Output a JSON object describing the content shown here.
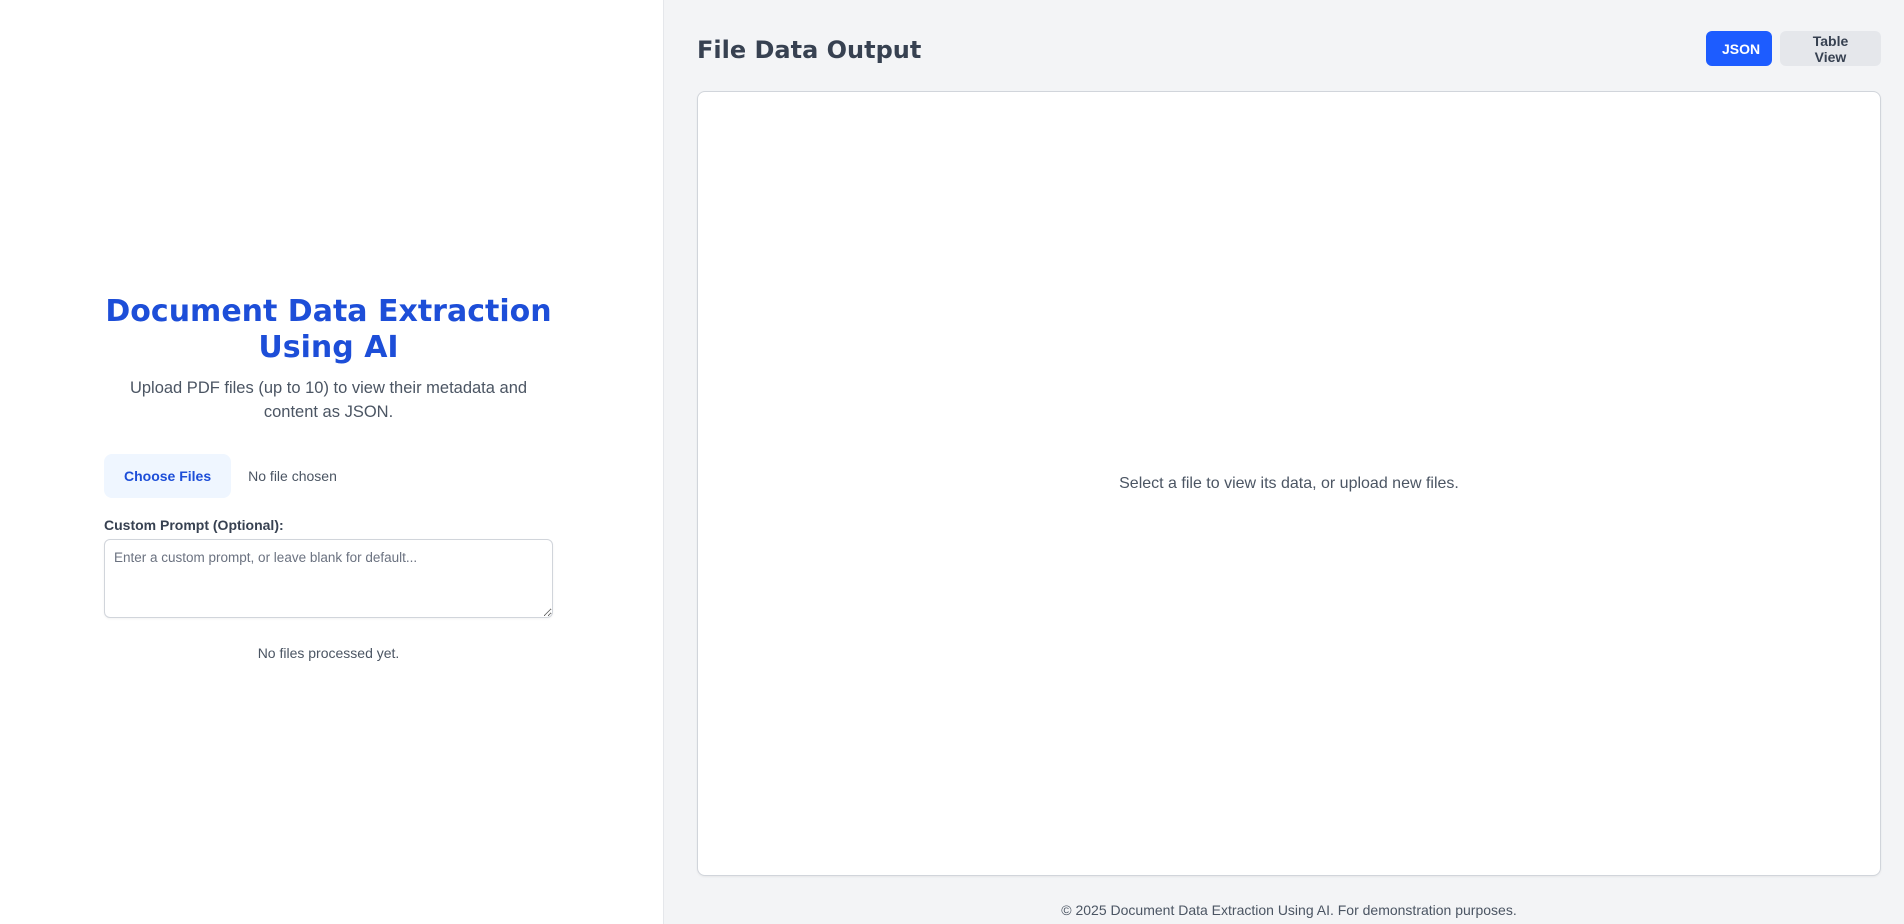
{
  "left": {
    "title_line1": "Document Data Extraction",
    "title_line2": "Using AI",
    "subtitle": "Upload PDF files (up to 10) to view their metadata and content as JSON.",
    "choose_files_label": "Choose Files",
    "file_status": "No file chosen",
    "prompt_label": "Custom Prompt (Optional):",
    "prompt_placeholder": "Enter a custom prompt, or leave blank for default...",
    "prompt_value": "",
    "processed_status": "No files processed yet."
  },
  "right": {
    "title": "File Data Output",
    "views": {
      "json_label": "JSON",
      "table_label": "Table View",
      "active": "JSON"
    },
    "empty_message": "Select a file to view its data, or upload new files.",
    "footer": "© 2025 Document Data Extraction Using AI. For demonstration purposes."
  },
  "colors": {
    "accent": "#1d4ed8",
    "active_button": "#1d5cff",
    "panel_background": "#f3f4f6"
  }
}
